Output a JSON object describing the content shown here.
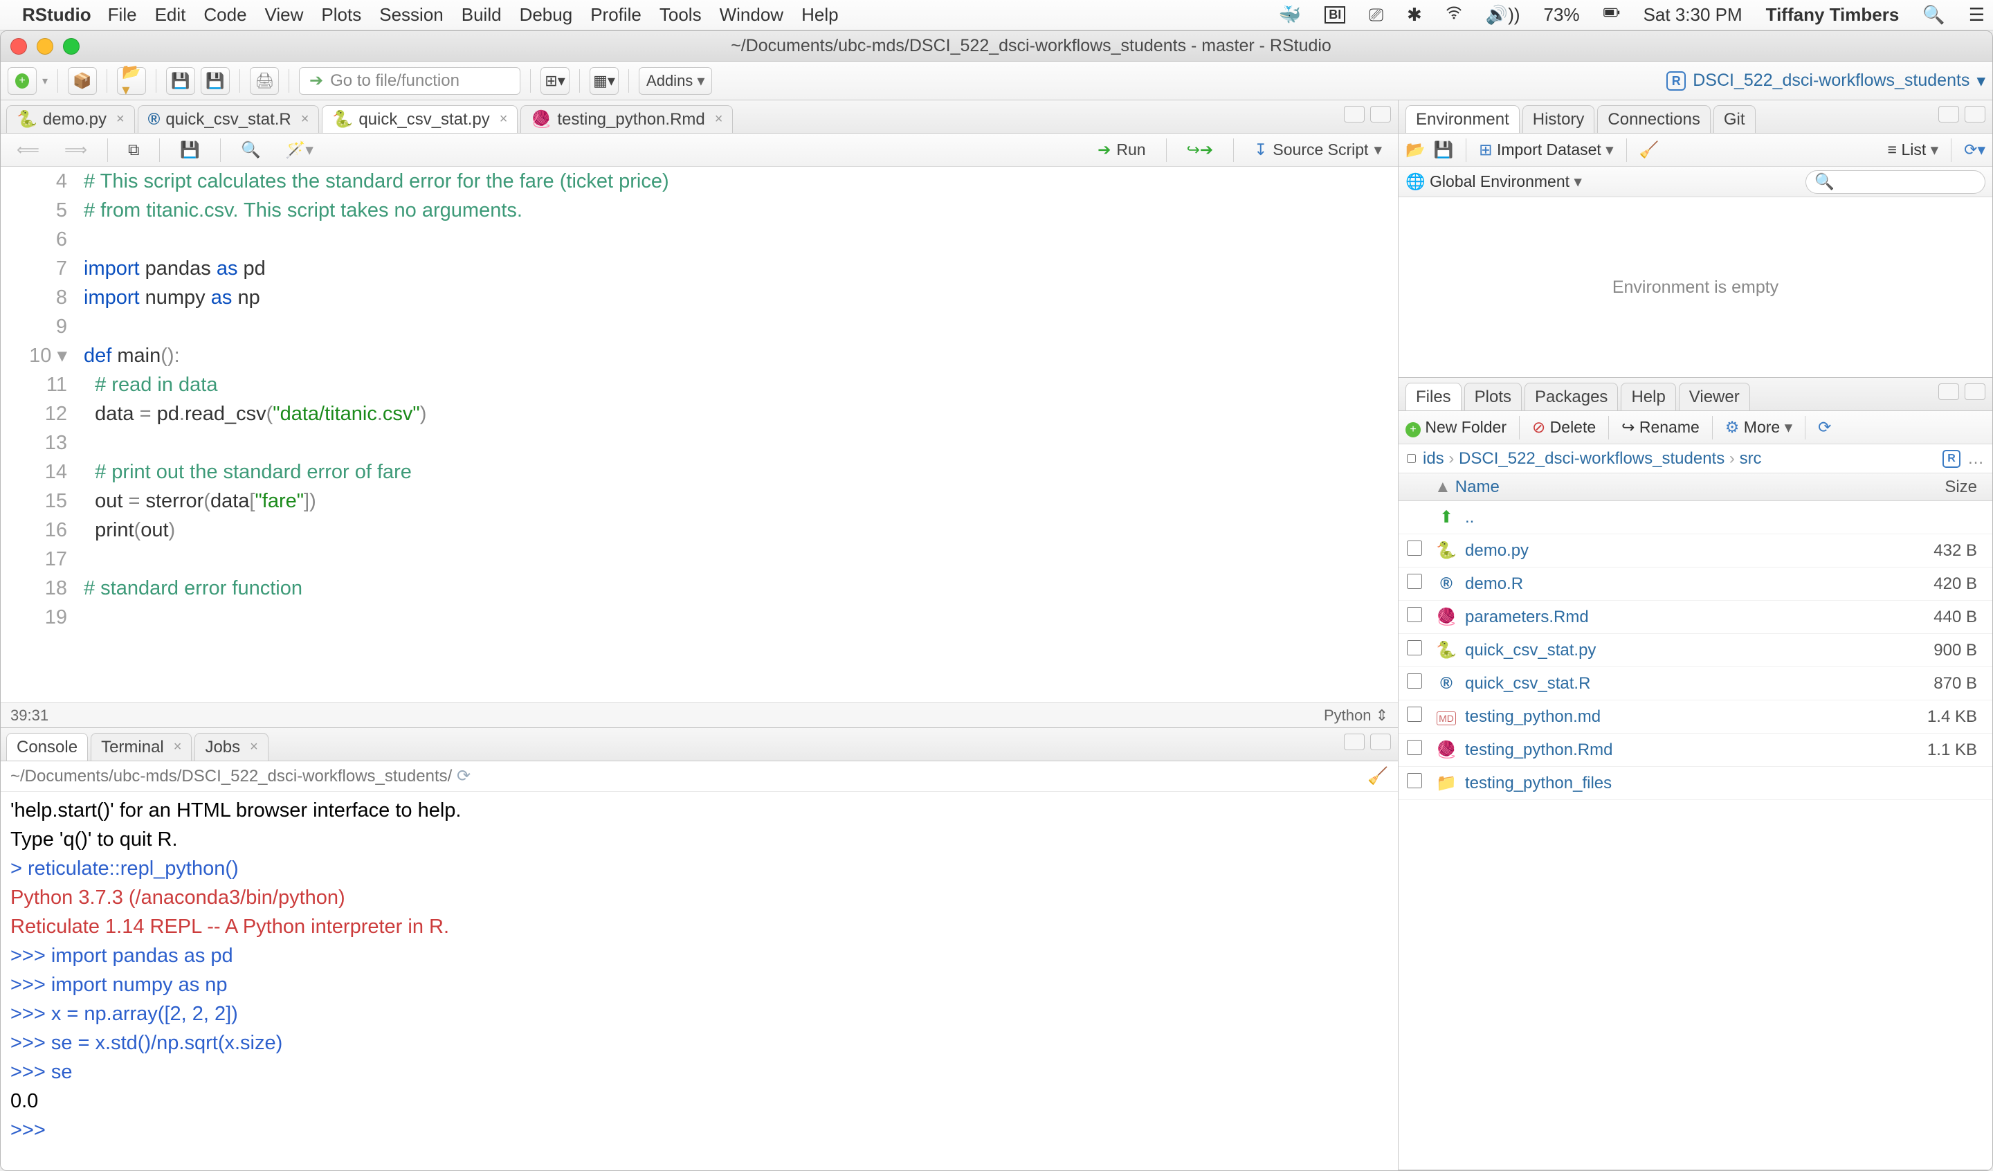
{
  "menubar": {
    "appname": "RStudio",
    "items": [
      "File",
      "Edit",
      "Code",
      "View",
      "Plots",
      "Session",
      "Build",
      "Debug",
      "Profile",
      "Tools",
      "Window",
      "Help"
    ],
    "battery": "73%",
    "datetime": "Sat 3:30 PM",
    "username": "Tiffany Timbers"
  },
  "window": {
    "title": "~/Documents/ubc-mds/DSCI_522_dsci-workflows_students - master - RStudio"
  },
  "toolbar": {
    "goto_placeholder": "Go to file/function",
    "addins": "Addins",
    "project": "DSCI_522_dsci-workflows_students"
  },
  "source": {
    "tabs": [
      {
        "label": "demo.py",
        "type": "py"
      },
      {
        "label": "quick_csv_stat.R",
        "type": "R"
      },
      {
        "label": "quick_csv_stat.py",
        "type": "py",
        "active": true
      },
      {
        "label": "testing_python.Rmd",
        "type": "Rmd"
      }
    ],
    "toolbar": {
      "run": "Run",
      "source": "Source Script"
    },
    "status_pos": "39:31",
    "status_lang": "Python",
    "lines": [
      {
        "n": 4,
        "raw": "# This script calculates the standard error for the fare (ticket price)",
        "cls": "cmt"
      },
      {
        "n": 5,
        "raw": "# from titanic.csv. This script takes no arguments.",
        "cls": "cmt"
      },
      {
        "n": 6,
        "raw": ""
      },
      {
        "n": 7,
        "raw": "import pandas as pd",
        "cls": "imp"
      },
      {
        "n": 8,
        "raw": "import numpy as np",
        "cls": "imp"
      },
      {
        "n": 9,
        "raw": ""
      },
      {
        "n": 10,
        "raw": "def main():",
        "fold": true,
        "cls": "def"
      },
      {
        "n": 11,
        "raw": "  # read in data",
        "cls": "cmt"
      },
      {
        "n": 12,
        "raw": "  data = pd.read_csv(\"data/titanic.csv\")",
        "cls": "call"
      },
      {
        "n": 13,
        "raw": ""
      },
      {
        "n": 14,
        "raw": "  # print out the standard error of fare",
        "cls": "cmt"
      },
      {
        "n": 15,
        "raw": "  out = sterror(data[\"fare\"])",
        "cls": "call"
      },
      {
        "n": 16,
        "raw": "  print(out)",
        "cls": "call"
      },
      {
        "n": 17,
        "raw": ""
      },
      {
        "n": 18,
        "raw": "# standard error function",
        "cls": "cmt"
      },
      {
        "n": 19,
        "raw": ""
      }
    ]
  },
  "console": {
    "tabs": [
      "Console",
      "Terminal",
      "Jobs"
    ],
    "path": "~/Documents/ubc-mds/DSCI_522_dsci-workflows_students/",
    "lines": [
      {
        "t": "'help.start()' for an HTML browser interface to help."
      },
      {
        "t": "Type 'q()' to quit R."
      },
      {
        "t": ""
      },
      {
        "t": "> reticulate::repl_python()",
        "c": "cl-blue"
      },
      {
        "t": "Python 3.7.3 (/anaconda3/bin/python)",
        "c": "cl-red"
      },
      {
        "t": "Reticulate 1.14 REPL -- A Python interpreter in R.",
        "c": "cl-red"
      },
      {
        "t": ">>> import pandas as pd",
        "c": "cl-blue"
      },
      {
        "t": ">>> import numpy as np",
        "c": "cl-blue"
      },
      {
        "t": ">>> x = np.array([2, 2, 2])",
        "c": "cl-blue"
      },
      {
        "t": ">>> se = x.std()/np.sqrt(x.size)",
        "c": "cl-blue"
      },
      {
        "t": ">>> se",
        "c": "cl-blue"
      },
      {
        "t": "0.0"
      },
      {
        "t": ">>>",
        "c": "cl-blue"
      }
    ]
  },
  "env": {
    "tabs": [
      "Environment",
      "History",
      "Connections",
      "Git"
    ],
    "import": "Import Dataset",
    "view": "List",
    "scope": "Global Environment",
    "empty": "Environment is empty"
  },
  "files": {
    "tabs": [
      "Files",
      "Plots",
      "Packages",
      "Help",
      "Viewer"
    ],
    "newfolder": "New Folder",
    "delete": "Delete",
    "rename": "Rename",
    "more": "More",
    "crumb": [
      "ids",
      "DSCI_522_dsci-workflows_students",
      "src"
    ],
    "hdr_name": "Name",
    "hdr_size": "Size",
    "up": "..",
    "rows": [
      {
        "name": "demo.py",
        "size": "432 B",
        "icon": "py"
      },
      {
        "name": "demo.R",
        "size": "420 B",
        "icon": "R"
      },
      {
        "name": "parameters.Rmd",
        "size": "440 B",
        "icon": "Rmd"
      },
      {
        "name": "quick_csv_stat.py",
        "size": "900 B",
        "icon": "py"
      },
      {
        "name": "quick_csv_stat.R",
        "size": "870 B",
        "icon": "R"
      },
      {
        "name": "testing_python.md",
        "size": "1.4 KB",
        "icon": "md"
      },
      {
        "name": "testing_python.Rmd",
        "size": "1.1 KB",
        "icon": "Rmd"
      },
      {
        "name": "testing_python_files",
        "size": "",
        "icon": "folder"
      }
    ]
  }
}
